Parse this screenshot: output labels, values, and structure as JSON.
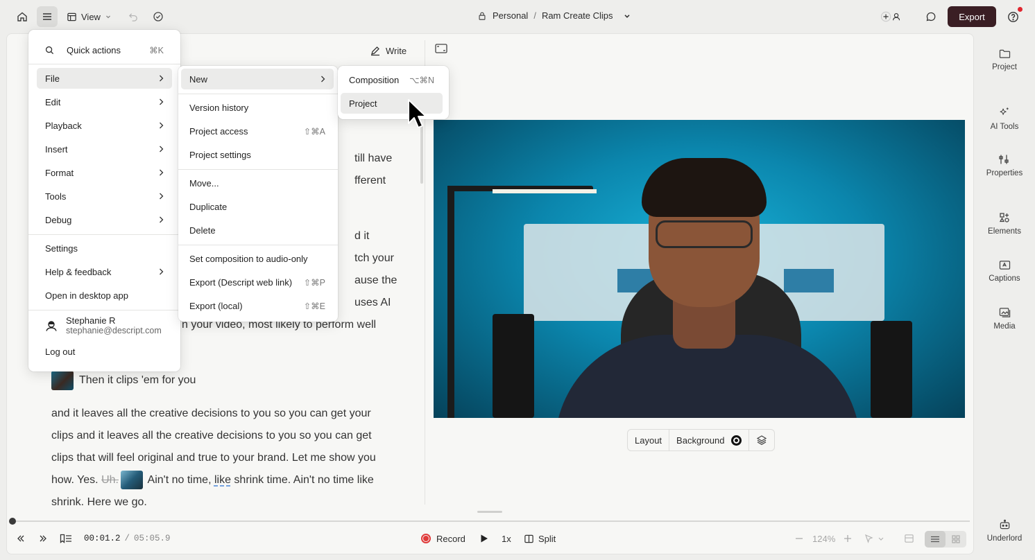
{
  "topbar": {
    "view_label": "View",
    "workspace": "Personal",
    "separator": "/",
    "project_name": "Ram Create Clips",
    "export_label": "Export",
    "colors": {
      "export_bg": "#3a1e24",
      "notification": "#e0262f"
    }
  },
  "editor": {
    "write_label": "Write",
    "fragments": [
      "till have",
      "fferent",
      "d it",
      "tch your",
      "ause the",
      "uses AI",
      "n your video, most likely to perform well"
    ],
    "clip_line": "Then it clips 'em for you",
    "para": {
      "text1": "and it leaves all the creative decisions to you so you can get your clips and it leaves all the creative decisions to you so you can get clips that will feel original and true to your brand. Let me show you how. Yes. ",
      "struck": "Uh.",
      "text2": " Ain't no time, ",
      "underlined": "like",
      "text3": " shrink time. Ain't no time like shrink. Here we go."
    }
  },
  "canvas": {
    "layout_label": "Layout",
    "background_label": "Background"
  },
  "playback": {
    "current_time": "00:01.2",
    "time_sep": "/",
    "total_time": "05:05.9",
    "record_label": "Record",
    "speed": "1x",
    "split_label": "Split",
    "zoom": "124%"
  },
  "rail": {
    "items": [
      {
        "label": "Project",
        "icon": "folder-icon"
      },
      {
        "label": "AI Tools",
        "icon": "sparkle-icon"
      },
      {
        "label": "Properties",
        "icon": "sliders-icon"
      },
      {
        "label": "Elements",
        "icon": "shapes-icon"
      },
      {
        "label": "Captions",
        "icon": "captions-icon"
      },
      {
        "label": "Media",
        "icon": "media-icon"
      },
      {
        "label": "Underlord",
        "icon": "robot-icon"
      }
    ]
  },
  "main_menu": {
    "quick_actions": {
      "label": "Quick actions",
      "shortcut": "⌘K"
    },
    "items": [
      {
        "label": "File"
      },
      {
        "label": "Edit"
      },
      {
        "label": "Playback"
      },
      {
        "label": "Insert"
      },
      {
        "label": "Format"
      },
      {
        "label": "Tools"
      },
      {
        "label": "Debug"
      }
    ],
    "settings": "Settings",
    "help": "Help & feedback",
    "desktop": "Open in desktop app",
    "user": {
      "name": "Stephanie R",
      "email": "stephanie@descript.com"
    },
    "logout": "Log out"
  },
  "file_menu": {
    "new": "New",
    "version_history": "Version history",
    "project_access": {
      "label": "Project access",
      "shortcut": "⇧⌘A"
    },
    "project_settings": "Project settings",
    "move": "Move...",
    "duplicate": "Duplicate",
    "delete": "Delete",
    "audio_only": "Set composition to audio-only",
    "export_web": {
      "label": "Export (Descript web link)",
      "shortcut": "⇧⌘P"
    },
    "export_local": {
      "label": "Export (local)",
      "shortcut": "⇧⌘E"
    }
  },
  "new_menu": {
    "composition": {
      "label": "Composition",
      "shortcut": "⌥⌘N"
    },
    "project": {
      "label": "Project"
    }
  }
}
